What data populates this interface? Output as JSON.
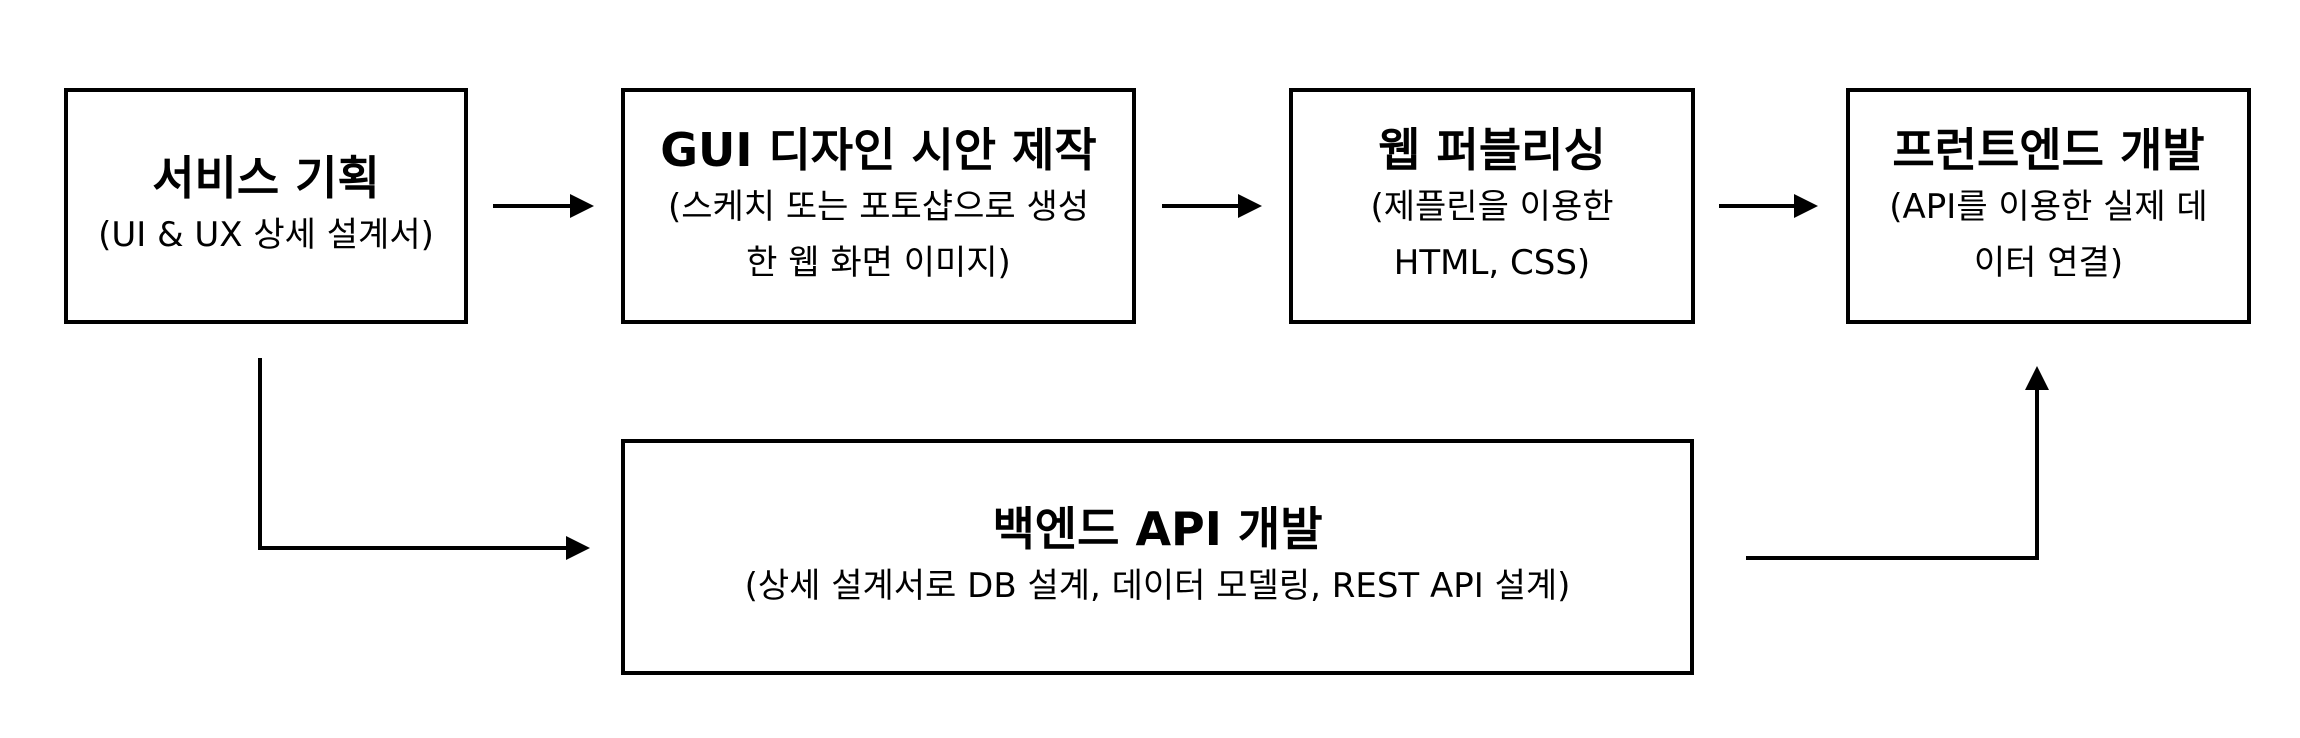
{
  "steps": {
    "planning": {
      "title": "서비스 기획",
      "desc": "(UI & UX 상세 설계서)"
    },
    "gui_design": {
      "title": "GUI 디자인 시안 제작",
      "desc_line1": "(스케치 또는 포토샵으로 생성",
      "desc_line2": "한 웹 화면 이미지)"
    },
    "publishing": {
      "title": "웹 퍼블리싱",
      "desc_line1": "(제플린을 이용한",
      "desc_line2": "HTML, CSS)"
    },
    "frontend": {
      "title": "프런트엔드 개발",
      "desc_line1": "(API를 이용한 실제 데",
      "desc_line2": "이터 연결)"
    },
    "backend": {
      "title": "백엔드 API 개발",
      "desc": "(상세 설계서로 DB 설계, 데이터 모델링, REST API 설계)"
    }
  },
  "colors": {
    "stroke": "#000000",
    "background": "#ffffff"
  }
}
